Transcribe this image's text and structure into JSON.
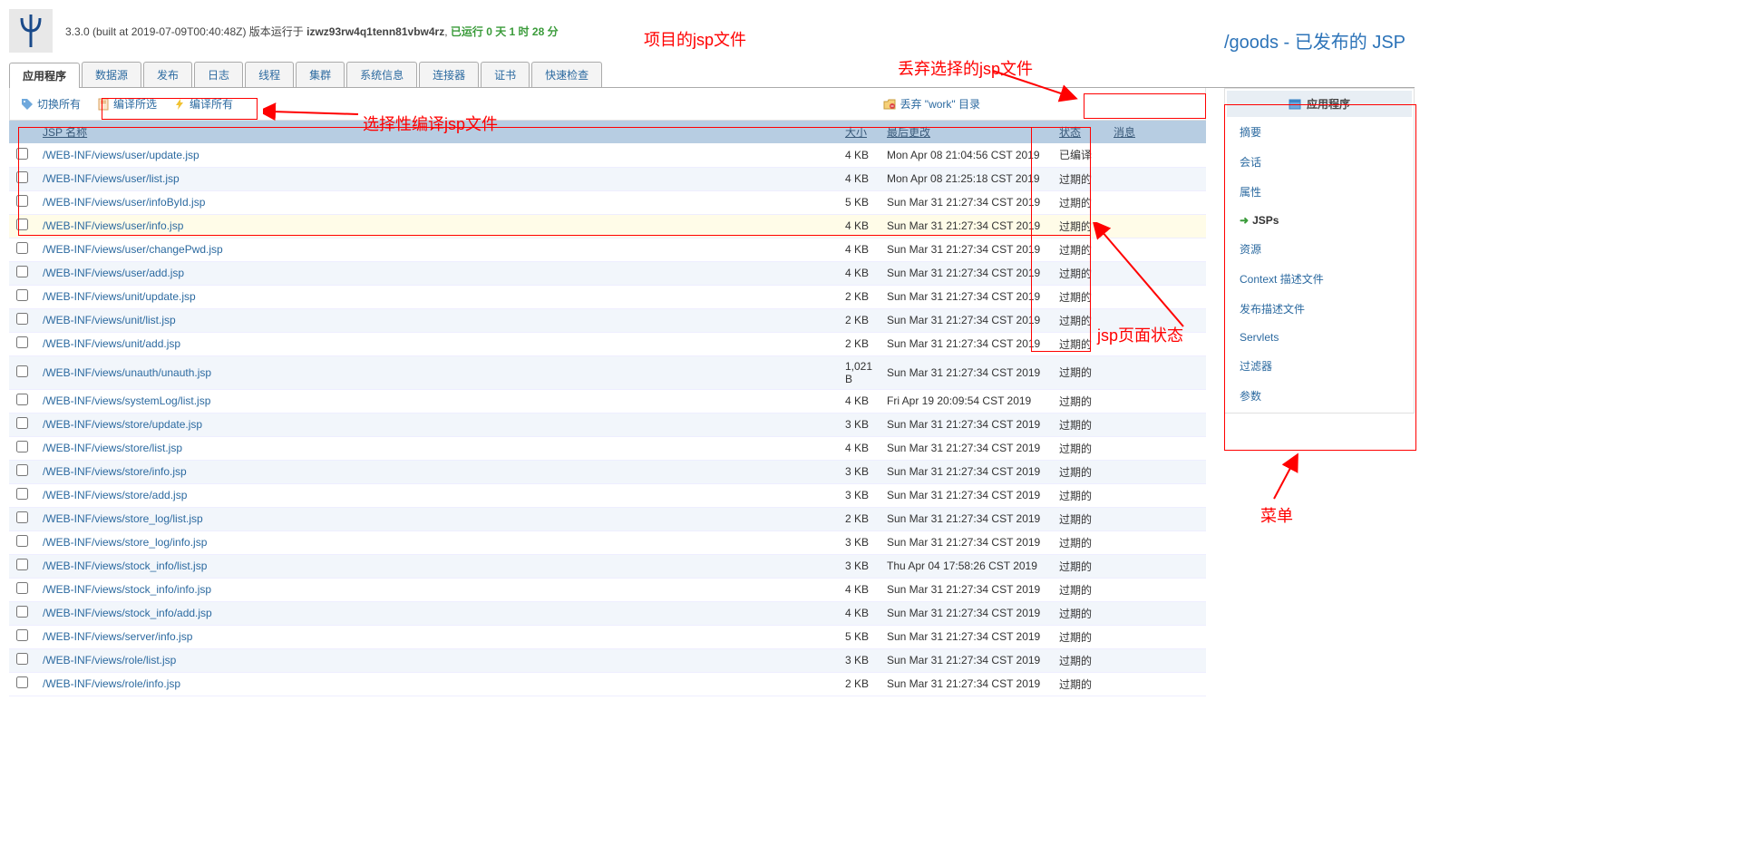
{
  "header": {
    "version_prefix": "3.3.0 (built at 2019-07-09T00:40:48Z) 版本运行于 ",
    "server": "izwz93rw4q1tenn81vbw4rz",
    "runtime_prefix": ", ",
    "runtime": "已运行 0 天 1 时 28 分"
  },
  "breadcrumb": "/goods - 已发布的 JSP",
  "tabs": [
    "应用程序",
    "数据源",
    "发布",
    "日志",
    "线程",
    "集群",
    "系统信息",
    "连接器",
    "证书",
    "快速检查"
  ],
  "toolbar": {
    "toggle_all": "切换所有",
    "compile_selected": "编译所选",
    "compile_all": "编译所有",
    "discard_work": "丢弃 \"work\" 目录"
  },
  "table": {
    "headers": {
      "chk": "",
      "name": "JSP 名称",
      "size": "大小",
      "modified": "最后更改",
      "status": "状态",
      "msg": "消息"
    },
    "rows": [
      {
        "path": "/WEB-INF/views/user/update.jsp",
        "size": "4 KB",
        "date": "Mon Apr 08 21:04:56 CST 2019",
        "status": "已编译"
      },
      {
        "path": "/WEB-INF/views/user/list.jsp",
        "size": "4 KB",
        "date": "Mon Apr 08 21:25:18 CST 2019",
        "status": "过期的"
      },
      {
        "path": "/WEB-INF/views/user/infoById.jsp",
        "size": "5 KB",
        "date": "Sun Mar 31 21:27:34 CST 2019",
        "status": "过期的"
      },
      {
        "path": "/WEB-INF/views/user/info.jsp",
        "size": "4 KB",
        "date": "Sun Mar 31 21:27:34 CST 2019",
        "status": "过期的",
        "highlight": true
      },
      {
        "path": "/WEB-INF/views/user/changePwd.jsp",
        "size": "4 KB",
        "date": "Sun Mar 31 21:27:34 CST 2019",
        "status": "过期的"
      },
      {
        "path": "/WEB-INF/views/user/add.jsp",
        "size": "4 KB",
        "date": "Sun Mar 31 21:27:34 CST 2019",
        "status": "过期的"
      },
      {
        "path": "/WEB-INF/views/unit/update.jsp",
        "size": "2 KB",
        "date": "Sun Mar 31 21:27:34 CST 2019",
        "status": "过期的"
      },
      {
        "path": "/WEB-INF/views/unit/list.jsp",
        "size": "2 KB",
        "date": "Sun Mar 31 21:27:34 CST 2019",
        "status": "过期的"
      },
      {
        "path": "/WEB-INF/views/unit/add.jsp",
        "size": "2 KB",
        "date": "Sun Mar 31 21:27:34 CST 2019",
        "status": "过期的"
      },
      {
        "path": "/WEB-INF/views/unauth/unauth.jsp",
        "size": "1,021 B",
        "date": "Sun Mar 31 21:27:34 CST 2019",
        "status": "过期的"
      },
      {
        "path": "/WEB-INF/views/systemLog/list.jsp",
        "size": "4 KB",
        "date": "Fri Apr 19 20:09:54 CST 2019",
        "status": "过期的"
      },
      {
        "path": "/WEB-INF/views/store/update.jsp",
        "size": "3 KB",
        "date": "Sun Mar 31 21:27:34 CST 2019",
        "status": "过期的"
      },
      {
        "path": "/WEB-INF/views/store/list.jsp",
        "size": "4 KB",
        "date": "Sun Mar 31 21:27:34 CST 2019",
        "status": "过期的"
      },
      {
        "path": "/WEB-INF/views/store/info.jsp",
        "size": "3 KB",
        "date": "Sun Mar 31 21:27:34 CST 2019",
        "status": "过期的"
      },
      {
        "path": "/WEB-INF/views/store/add.jsp",
        "size": "3 KB",
        "date": "Sun Mar 31 21:27:34 CST 2019",
        "status": "过期的"
      },
      {
        "path": "/WEB-INF/views/store_log/list.jsp",
        "size": "2 KB",
        "date": "Sun Mar 31 21:27:34 CST 2019",
        "status": "过期的"
      },
      {
        "path": "/WEB-INF/views/store_log/info.jsp",
        "size": "3 KB",
        "date": "Sun Mar 31 21:27:34 CST 2019",
        "status": "过期的"
      },
      {
        "path": "/WEB-INF/views/stock_info/list.jsp",
        "size": "3 KB",
        "date": "Thu Apr 04 17:58:26 CST 2019",
        "status": "过期的"
      },
      {
        "path": "/WEB-INF/views/stock_info/info.jsp",
        "size": "4 KB",
        "date": "Sun Mar 31 21:27:34 CST 2019",
        "status": "过期的"
      },
      {
        "path": "/WEB-INF/views/stock_info/add.jsp",
        "size": "4 KB",
        "date": "Sun Mar 31 21:27:34 CST 2019",
        "status": "过期的"
      },
      {
        "path": "/WEB-INF/views/server/info.jsp",
        "size": "5 KB",
        "date": "Sun Mar 31 21:27:34 CST 2019",
        "status": "过期的"
      },
      {
        "path": "/WEB-INF/views/role/list.jsp",
        "size": "3 KB",
        "date": "Sun Mar 31 21:27:34 CST 2019",
        "status": "过期的"
      },
      {
        "path": "/WEB-INF/views/role/info.jsp",
        "size": "2 KB",
        "date": "Sun Mar 31 21:27:34 CST 2019",
        "status": "过期的"
      }
    ]
  },
  "side": {
    "title": "应用程序",
    "items": [
      "摘要",
      "会话",
      "属性",
      "JSPs",
      "资源",
      "Context 描述文件",
      "发布描述文件",
      "Servlets",
      "过滤器",
      "参数"
    ],
    "active_index": 3
  },
  "annotations": {
    "a1": "项目的jsp文件",
    "a2": "丢弃选择的jsp文件",
    "a3": "选择性编译jsp文件",
    "a4": "jsp页面状态",
    "a5": "菜单"
  }
}
